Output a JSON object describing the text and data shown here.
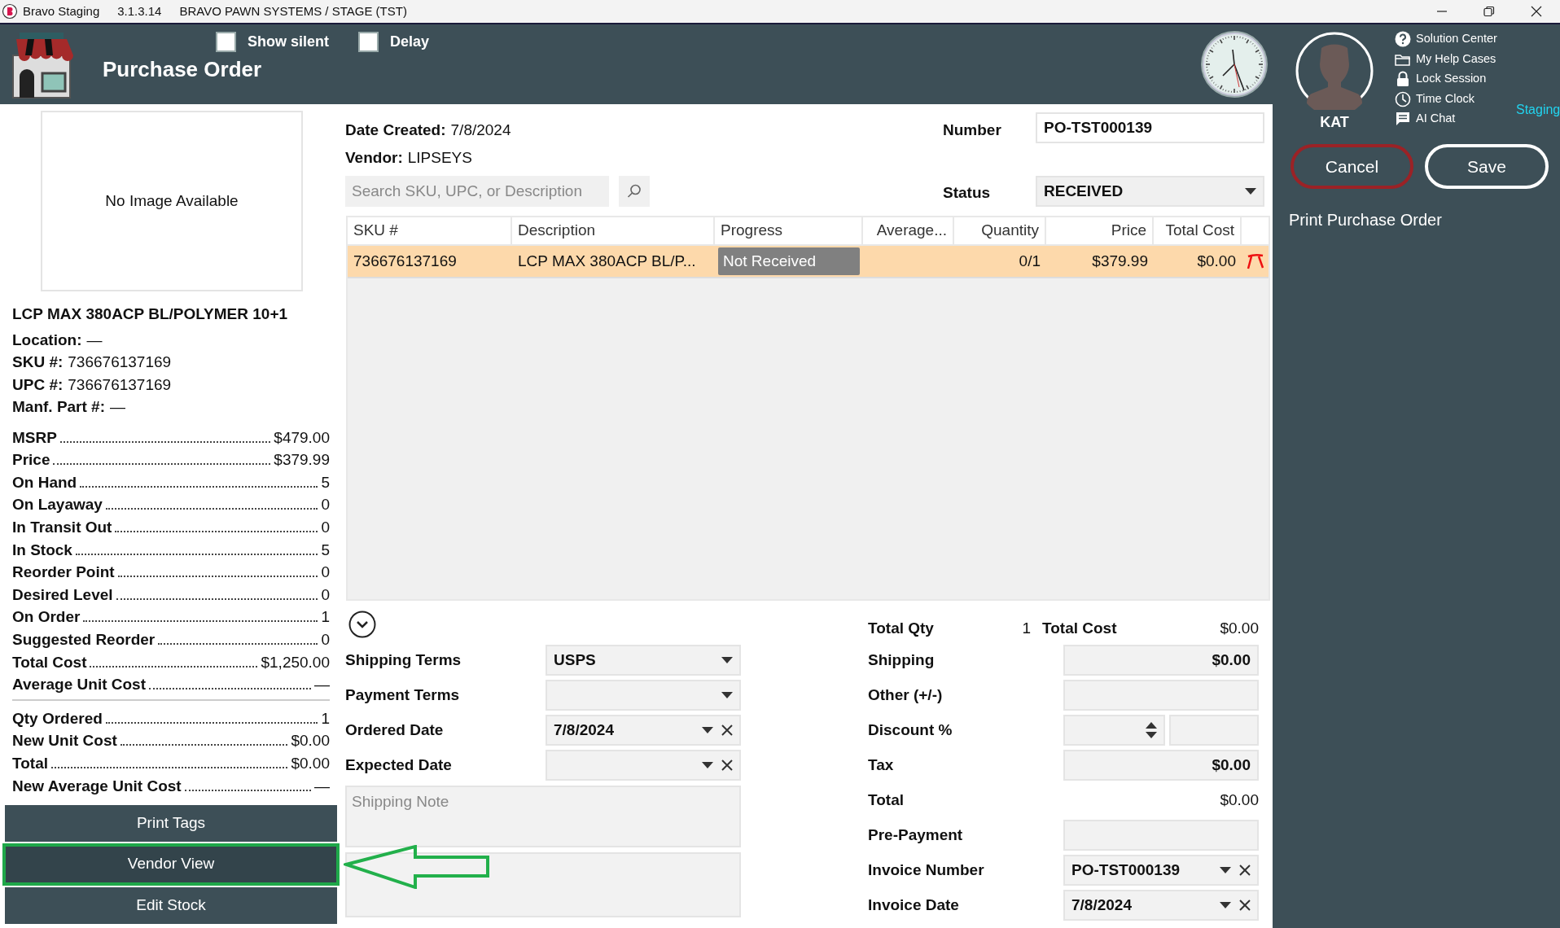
{
  "title_bar": {
    "app": "Bravo Staging",
    "version": "3.1.3.14",
    "company": "BRAVO PAWN SYSTEMS / STAGE (TST)"
  },
  "header": {
    "title": "Purchase Order",
    "toggles": [
      {
        "label": "Show silent",
        "checked": false
      },
      {
        "label": "Delay",
        "checked": false
      }
    ],
    "user": "KAT",
    "links": [
      {
        "label": "Solution Center",
        "kind": "help"
      },
      {
        "label": "My Help Cases",
        "kind": "folder"
      },
      {
        "label": "Lock Session",
        "kind": "lock"
      },
      {
        "label": "Time Clock",
        "kind": "clock"
      },
      {
        "label": "AI Chat",
        "kind": "chat"
      }
    ],
    "environment": "Staging"
  },
  "side_actions": {
    "cancel": "Cancel",
    "save": "Save",
    "print": "Print Purchase Order"
  },
  "item_panel": {
    "image_text": "No Image Available",
    "name": "LCP MAX 380ACP BL/POLYMER 10+1",
    "details": [
      {
        "label": "Location:",
        "value": "—"
      },
      {
        "label": "SKU #:",
        "value": "736676137169"
      },
      {
        "label": "UPC #:",
        "value": "736676137169"
      },
      {
        "label": "Manf. Part #:",
        "value": "—"
      }
    ],
    "stats": [
      {
        "label": "MSRP",
        "value": "$479.00"
      },
      {
        "label": "Price",
        "value": "$379.99"
      },
      {
        "label": "On Hand",
        "value": "5"
      },
      {
        "label": "On Layaway",
        "value": "0"
      },
      {
        "label": "In Transit Out",
        "value": "0"
      },
      {
        "label": "In Stock",
        "value": "5"
      },
      {
        "label": "Reorder Point",
        "value": "0"
      },
      {
        "label": "Desired Level",
        "value": "0"
      },
      {
        "label": "On Order",
        "value": "1"
      },
      {
        "label": "Suggested Reorder",
        "value": "0"
      },
      {
        "label": "Total Cost",
        "value": "$1,250.00"
      },
      {
        "label": "Average Unit Cost",
        "value": "—"
      }
    ],
    "order_stats": [
      {
        "label": "Qty Ordered",
        "value": "1"
      },
      {
        "label": "New Unit Cost",
        "value": "$0.00"
      },
      {
        "label": "Total",
        "value": "$0.00"
      },
      {
        "label": "New Average Unit Cost",
        "value": "—"
      }
    ],
    "buttons": [
      {
        "label": "Print Tags",
        "highlighted": false
      },
      {
        "label": "Vendor View",
        "highlighted": true
      },
      {
        "label": "Edit Stock",
        "highlighted": false
      }
    ]
  },
  "order": {
    "date_created": {
      "label": "Date Created:",
      "value": "7/8/2024"
    },
    "vendor": {
      "label": "Vendor:",
      "value": "LIPSEYS"
    },
    "search": {
      "placeholder": "Search SKU, UPC, or Description"
    },
    "number": {
      "label": "Number",
      "value": "PO-TST000139"
    },
    "status": {
      "label": "Status",
      "value": "RECEIVED"
    },
    "table": {
      "columns": [
        {
          "label": "SKU #"
        },
        {
          "label": "Description"
        },
        {
          "label": "Progress"
        },
        {
          "label": "Average..."
        },
        {
          "label": "Quantity"
        },
        {
          "label": "Price"
        },
        {
          "label": "Total Cost"
        }
      ],
      "rows": [
        {
          "selected": true,
          "cells": [
            "736676137169",
            "LCP MAX 380ACP BL/P...",
            "Not Received",
            "",
            "0/1",
            "$379.99",
            "$0.00"
          ]
        }
      ]
    },
    "terms": [
      {
        "label": "Shipping Terms",
        "kind": "dropdown",
        "value": "USPS"
      },
      {
        "label": "Payment Terms",
        "kind": "dropdown"
      },
      {
        "label": "Ordered Date",
        "kind": "date",
        "value": "7/8/2024"
      },
      {
        "label": "Expected Date",
        "kind": "date"
      }
    ],
    "shipping_note": {
      "placeholder": "Shipping Note"
    },
    "summary": [
      {
        "label": "Total Qty",
        "kind": "pair",
        "value": "1",
        "label_2": "Total Cost",
        "value_2": "$0.00"
      },
      {
        "label": "Shipping",
        "kind": "field",
        "value": "$0.00"
      },
      {
        "label": "Other (+/-)",
        "kind": "field"
      },
      {
        "label": "Discount %",
        "kind": "spinner"
      },
      {
        "label": "Tax",
        "kind": "field",
        "value": "$0.00"
      },
      {
        "label": "Total",
        "kind": "text",
        "value": "$0.00"
      },
      {
        "label": "Pre-Payment",
        "kind": "field"
      },
      {
        "label": "Invoice Number",
        "kind": "combo",
        "value": "PO-TST000139"
      },
      {
        "label": "Invoice Date",
        "kind": "combo",
        "value": "7/8/2024"
      }
    ]
  }
}
